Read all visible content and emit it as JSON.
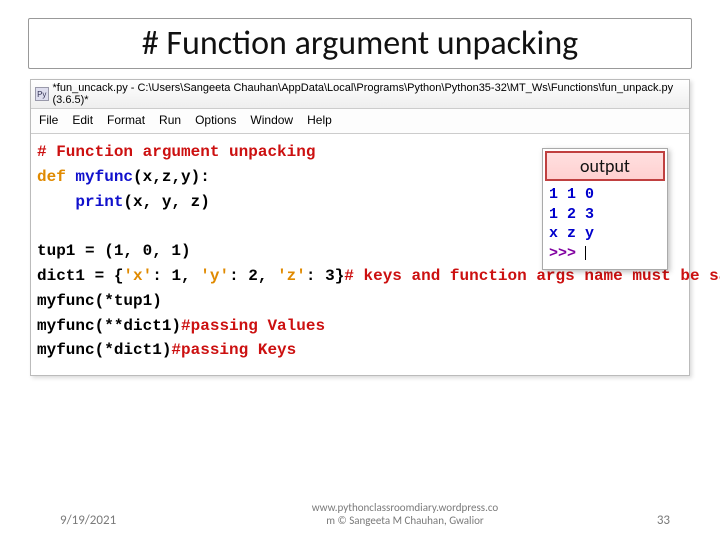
{
  "title": "# Function argument unpacking",
  "ide": {
    "icon": "Py",
    "window_title": "*fun_uncack.py - C:\\Users\\Sangeeta Chauhan\\AppData\\Local\\Programs\\Python\\Python35-32\\MT_Ws\\Functions\\fun_unpack.py (3.6.5)*",
    "menu": {
      "file": "File",
      "edit": "Edit",
      "format": "Format",
      "run": "Run",
      "options": "Options",
      "window": "Window",
      "help": "Help"
    },
    "code": {
      "l1": "# Function argument unpacking",
      "l2_def": "def",
      "l2_name": " myfunc",
      "l2_rest": "(x,z,y):",
      "l3_print": "    print",
      "l3_rest": "(x, y, z)",
      "l4": "",
      "l5": "tup1 = (1, 0, 1)",
      "l6a": "dict1 = {",
      "l6b": "'x'",
      "l6c": ": 1, ",
      "l6d": "'y'",
      "l6e": ": 2, ",
      "l6f": "'z'",
      "l6g": ": 3}",
      "l6h": "# keys and function args name must be same",
      "l7": "myfunc(*tup1)",
      "l8a": "myfunc(**dict1)",
      "l8b": "#passing Values",
      "l9a": "myfunc(*dict1)",
      "l9b": "#passing Keys"
    }
  },
  "output": {
    "label": "output",
    "rows": [
      "1 1 0",
      "1 2 3",
      "x z y"
    ],
    "prompt": ">>> "
  },
  "footer": {
    "date": "9/19/2021",
    "credit1": "www.pythonclassroomdiary.wordpress.co",
    "credit2": "m  © Sangeeta M Chauhan, Gwalior",
    "page": "33"
  }
}
